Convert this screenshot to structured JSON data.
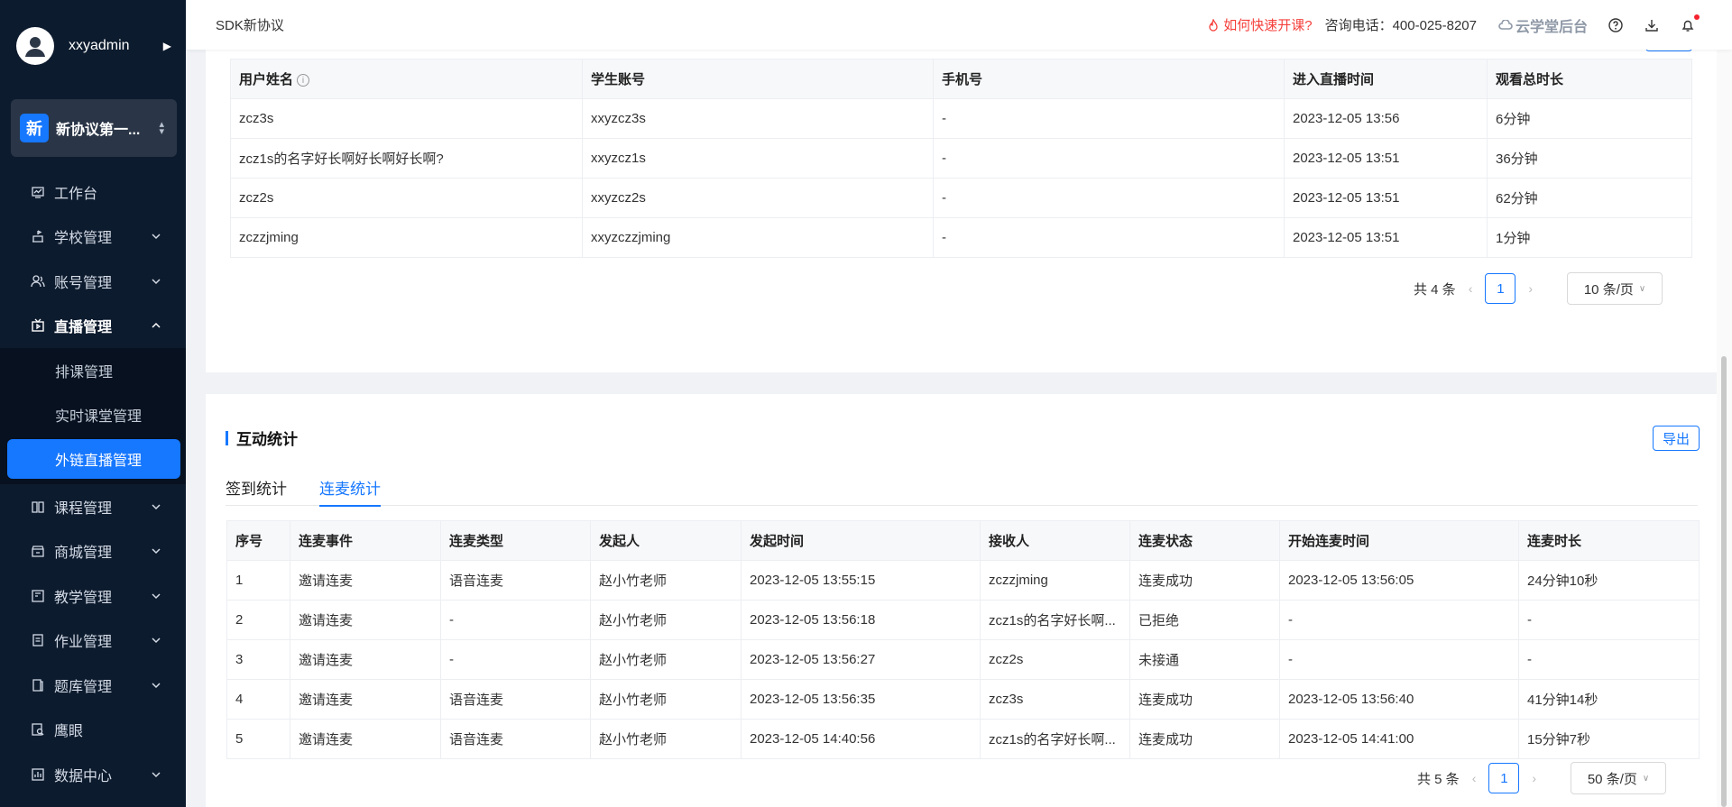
{
  "user": {
    "name": "xxyadmin"
  },
  "school": {
    "badge": "新",
    "name": "新协议第一..."
  },
  "menu": [
    {
      "label": "工作台",
      "icon": "dashboard-icon",
      "chevron": false
    },
    {
      "label": "学校管理",
      "icon": "school-icon",
      "chevron": true
    },
    {
      "label": "账号管理",
      "icon": "account-icon",
      "chevron": true
    },
    {
      "label": "直播管理",
      "icon": "live-icon",
      "chevron": true,
      "expanded": true
    }
  ],
  "submenu": [
    {
      "label": "排课管理"
    },
    {
      "label": "实时课堂管理"
    },
    {
      "label": "外链直播管理",
      "active": true
    }
  ],
  "menu2": [
    {
      "label": "课程管理",
      "icon": "course-icon",
      "chevron": true
    },
    {
      "label": "商城管理",
      "icon": "shop-icon",
      "chevron": true
    },
    {
      "label": "教学管理",
      "icon": "teaching-icon",
      "chevron": true
    },
    {
      "label": "作业管理",
      "icon": "homework-icon",
      "chevron": true
    },
    {
      "label": "题库管理",
      "icon": "question-bank-icon",
      "chevron": true
    },
    {
      "label": "鹰眼",
      "icon": "eagle-eye-icon",
      "chevron": false
    },
    {
      "label": "数据中心",
      "icon": "data-center-icon",
      "chevron": true
    }
  ],
  "header": {
    "title": "SDK新协议",
    "quick_link": "如何快速开课?",
    "phone": "咨询电话：400-025-8207",
    "brand": "云学堂后台"
  },
  "viewers": {
    "columns": [
      "用户姓名",
      "学生账号",
      "手机号",
      "进入直播时间",
      "观看总时长"
    ],
    "rows": [
      [
        "zcz3s",
        "xxyzcz3s",
        "-",
        "2023-12-05 13:56",
        "6分钟"
      ],
      [
        "zcz1s的名字好长啊好长啊好长啊?",
        "xxyzcz1s",
        "-",
        "2023-12-05 13:51",
        "36分钟"
      ],
      [
        "zcz2s",
        "xxyzcz2s",
        "-",
        "2023-12-05 13:51",
        "62分钟"
      ],
      [
        "zczzjming",
        "xxyzczzjming",
        "-",
        "2023-12-05 13:51",
        "1分钟"
      ]
    ],
    "pager": {
      "total": "共 4 条",
      "page": "1",
      "size": "10 条/页"
    }
  },
  "interaction": {
    "title": "互动统计",
    "export_label": "导出",
    "tabs": [
      "签到统计",
      "连麦统计"
    ],
    "active_tab": 1,
    "columns": [
      "序号",
      "连麦事件",
      "连麦类型",
      "发起人",
      "发起时间",
      "接收人",
      "连麦状态",
      "开始连麦时间",
      "连麦时长"
    ],
    "rows": [
      [
        "1",
        "邀请连麦",
        "语音连麦",
        "赵小竹老师",
        "2023-12-05 13:55:15",
        "zczzjming",
        "连麦成功",
        "2023-12-05 13:56:05",
        "24分钟10秒"
      ],
      [
        "2",
        "邀请连麦",
        "-",
        "赵小竹老师",
        "2023-12-05 13:56:18",
        "zcz1s的名字好长啊...",
        "已拒绝",
        "-",
        "-"
      ],
      [
        "3",
        "邀请连麦",
        "-",
        "赵小竹老师",
        "2023-12-05 13:56:27",
        "zcz2s",
        "未接通",
        "-",
        "-"
      ],
      [
        "4",
        "邀请连麦",
        "语音连麦",
        "赵小竹老师",
        "2023-12-05 13:56:35",
        "zcz3s",
        "连麦成功",
        "2023-12-05 13:56:40",
        "41分钟14秒"
      ],
      [
        "5",
        "邀请连麦",
        "语音连麦",
        "赵小竹老师",
        "2023-12-05 14:40:56",
        "zcz1s的名字好长啊...",
        "连麦成功",
        "2023-12-05 14:41:00",
        "15分钟7秒"
      ]
    ],
    "pager": {
      "total": "共 5 条",
      "page": "1",
      "size": "50 条/页"
    }
  },
  "colors": {
    "primary": "#1677ff",
    "sidebar": "#0d1b2e",
    "alert": "#f5413c"
  }
}
